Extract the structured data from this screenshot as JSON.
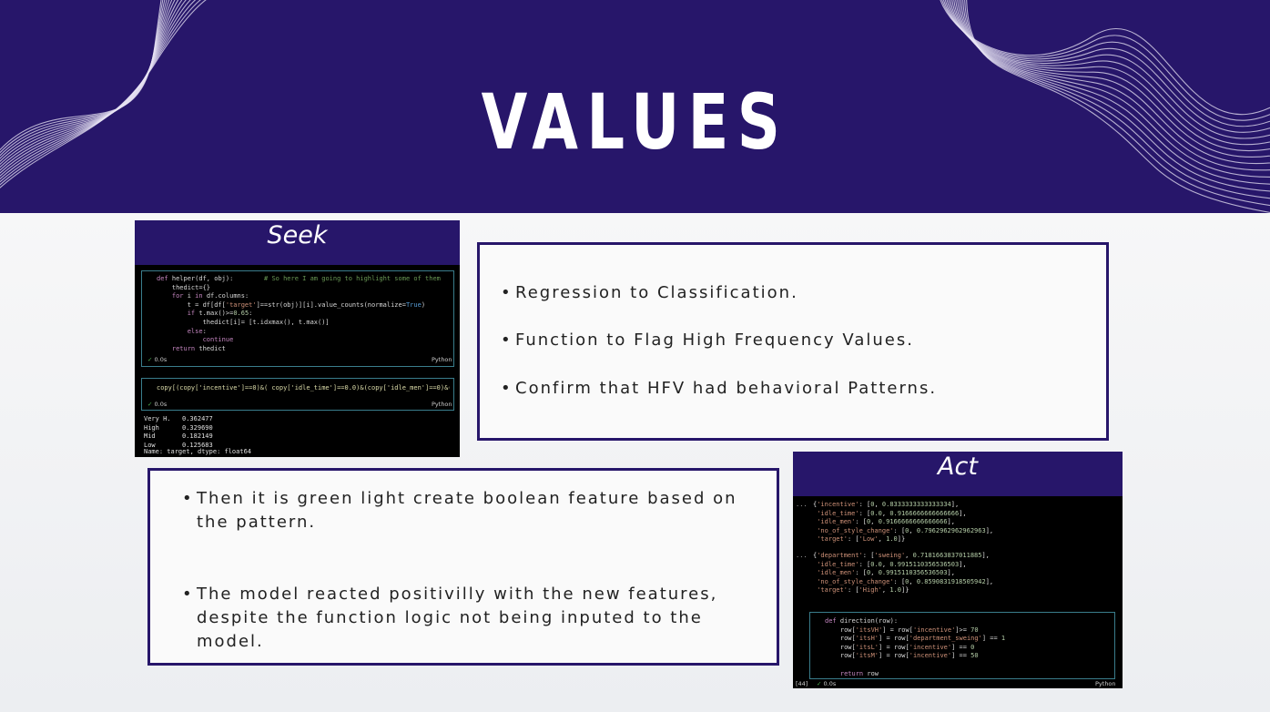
{
  "slide": {
    "title": "VALUES",
    "colors": {
      "header": "#27166a",
      "accent_border": "#27166a",
      "code_bg": "#000000"
    }
  },
  "seek_panel": {
    "label": "Seek",
    "code_cell_1": {
      "lines": [
        "def helper(df, obj):        # So here I am going to highlight some of them",
        "    thedict={}",
        "    for i in df.columns:",
        "        t = df[df['target']==str(obj)][i].value_counts(normalize=True)",
        "        if t.max()>=0.65:",
        "            thedict[i]= [t.idxmax(), t.max()]",
        "        else:",
        "            continue",
        "    return thedict"
      ],
      "status": "0.0s",
      "lang": "Python"
    },
    "code_cell_2": {
      "line": "copy[(copy['incentive']==0)&( copy['idle_time']==0.0)&(copy['idle_men']==0)&(copy['n",
      "status": "0.0s",
      "lang": "Python"
    },
    "output": [
      {
        "label": "Very H.",
        "value": "0.362477"
      },
      {
        "label": "High",
        "value": "0.329690"
      },
      {
        "label": "Mid",
        "value": "0.182149"
      },
      {
        "label": "Low",
        "value": "0.125683"
      }
    ],
    "output_footer": "Name: target, dtype: float64"
  },
  "top_box": {
    "bullets": [
      "Regression to Classification.",
      "Function to Flag High Frequency Values.",
      "Confirm that HFV had behavioral Patterns."
    ]
  },
  "bottom_box": {
    "bullets": [
      "Then it is green light create boolean feature based on\nthe pattern.",
      "The model reacted positivilly with the new features,\ndespite the function logic not being inputed to the\nmodel."
    ]
  },
  "act_panel": {
    "label": "Act",
    "prompt": "...",
    "output_1": [
      "{'incentive': [0, 0.8333333333333334],",
      " 'idle_time': [0.0, 0.9166666666666666],",
      " 'idle_men': [0, 0.9166666666666666],",
      " 'no_of_style_change': [0, 0.7962962962962963],",
      " 'target': ['Low', 1.0]}"
    ],
    "output_2": [
      "{'department': ['sweing', 0.7181663837011885],",
      " 'idle_time': [0.0, 0.9915110356536503],",
      " 'idle_men': [0, 0.9915110356536503],",
      " 'no_of_style_change': [0, 0.8590831918505942],",
      " 'target': ['High', 1.0]}"
    ],
    "code_cell": {
      "lines": [
        "def direction(row):",
        "    row['itsVH'] = row['incentive']>= 70",
        "    row['itsH'] = row['department_sweing'] == 1",
        "    row['itsL'] = row['incentive'] == 0",
        "    row['itsM'] = row['incentive'] == 50",
        "",
        "    return row"
      ],
      "exec_count": "[44]",
      "status": "0.0s",
      "lang": "Python"
    }
  }
}
